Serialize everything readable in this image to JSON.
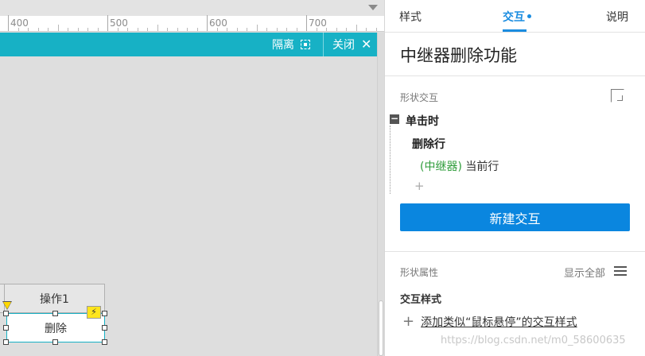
{
  "ruler": {
    "labels": [
      "400",
      "500",
      "600",
      "700"
    ]
  },
  "overlay": {
    "isolate_label": "隔离",
    "close_label": "关闭",
    "isolate_icon": "isolate-icon",
    "close_icon": "close-icon"
  },
  "canvas": {
    "header_cell_label": "操作1",
    "delete_label": "删除",
    "event_badge_icon": "lightning-icon"
  },
  "panel": {
    "tabs": [
      {
        "label": "样式"
      },
      {
        "label": "交互"
      },
      {
        "label": "说明"
      }
    ],
    "title": "中继器删除功能",
    "interactions": {
      "section_label": "形状交互",
      "event": "单击时",
      "action": "删除行",
      "target_repeater": "(中继器)",
      "target_text": " 当前行",
      "add_plus": "+",
      "new_button_label": "新建交互"
    },
    "properties": {
      "section_label": "形状属性",
      "show_all": "显示全部",
      "subsection": "交互样式",
      "add_style_label": "添加类似“鼠标悬停”的交互样式"
    }
  },
  "colors": {
    "accent": "#1a8ce0",
    "overlay_bar": "#17b1c5",
    "primary_button": "#0a86df",
    "repeater_text": "#2e9c3a",
    "event_badge": "#ffe51d"
  },
  "watermark": "https://blog.csdn.net/m0_58600635"
}
